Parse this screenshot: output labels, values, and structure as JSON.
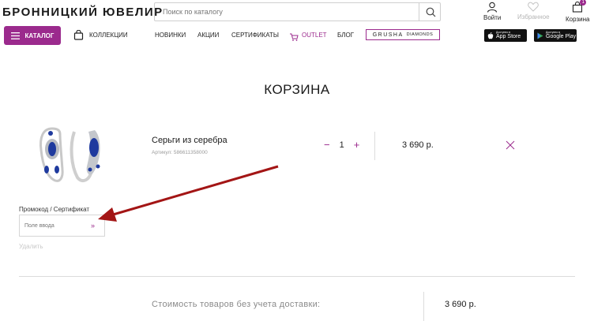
{
  "header": {
    "logo": "БРОННИЦКИЙ ЮВЕЛИР",
    "search_placeholder": "Поиск по каталогу",
    "login": "Войти",
    "favorites": "Избранное",
    "cart": "Корзина",
    "cart_count": "1"
  },
  "nav": {
    "catalog": "КАТАЛОГ",
    "collections": "КОЛЛЕКЦИИ",
    "items": [
      "НОВИНКИ",
      "АКЦИИ",
      "СЕРТИФИКАТЫ",
      "OUTLET",
      "БЛОГ"
    ],
    "grusha": "GRUSHA",
    "diamonds": "DIAMONDS",
    "appstore_small": "Доступно в",
    "appstore": "App Store",
    "googleplay_small": "Доступно в",
    "googleplay": "Google Play"
  },
  "cart": {
    "title": "КОРЗИНА",
    "product_name": "Серьги из серебра",
    "article": "Артикул: 586611358000",
    "quantity": "1",
    "price": "3 690 р.",
    "promo_label": "Промокод / Сертификат",
    "promo_placeholder": "Поле ввода",
    "delete": "Удалить",
    "summary_label": "Стоимость товаров без учета доставки:",
    "summary_value": "3 690 р."
  },
  "colors": {
    "accent": "#9b2a8d",
    "arrow": "#a31515"
  }
}
